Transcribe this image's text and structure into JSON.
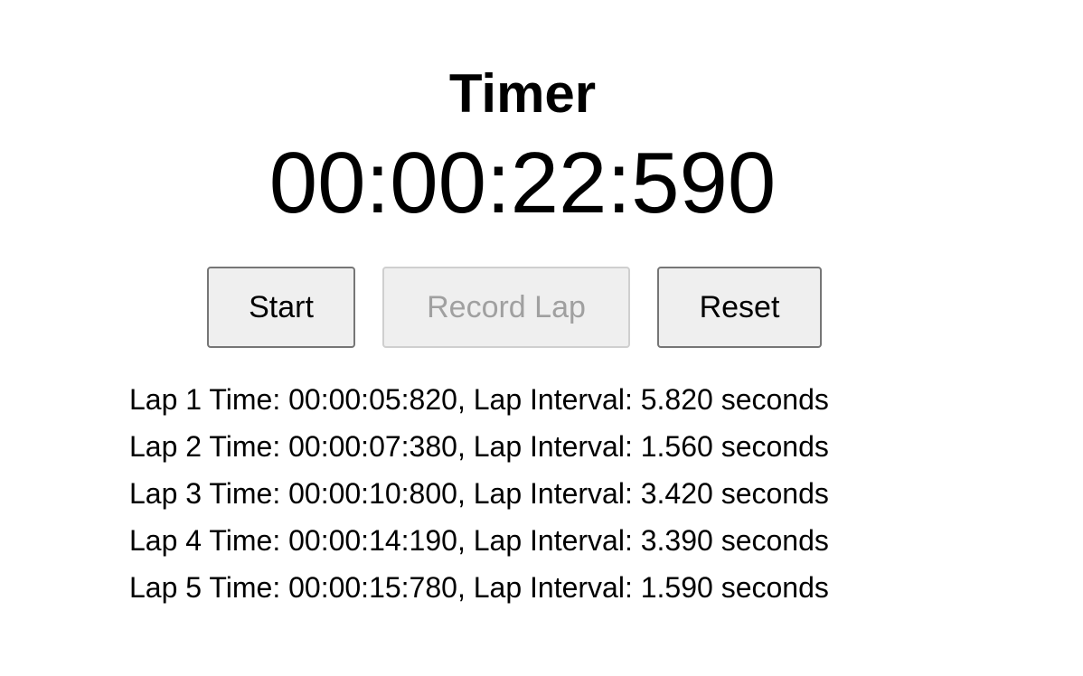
{
  "title": "Timer",
  "display": "00:00:22:590",
  "buttons": {
    "start": "Start",
    "record_lap": "Record Lap",
    "reset": "Reset"
  },
  "laps": [
    "Lap 1 Time: 00:00:05:820, Lap Interval: 5.820 seconds",
    "Lap 2 Time: 00:00:07:380, Lap Interval: 1.560 seconds",
    "Lap 3 Time: 00:00:10:800, Lap Interval: 3.420 seconds",
    "Lap 4 Time: 00:00:14:190, Lap Interval: 3.390 seconds",
    "Lap 5 Time: 00:00:15:780, Lap Interval: 1.590 seconds"
  ]
}
